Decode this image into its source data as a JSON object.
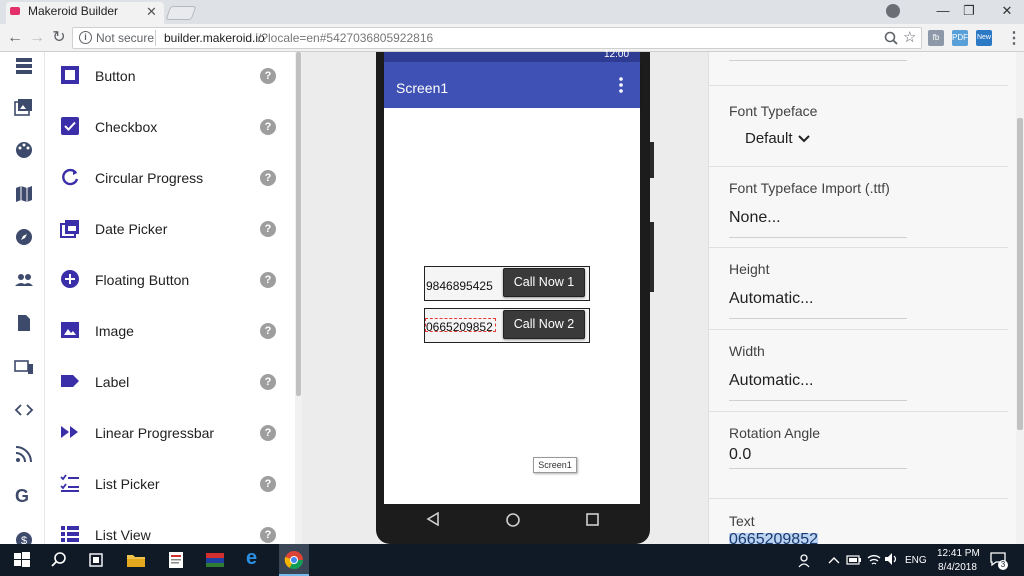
{
  "browser": {
    "tab_title": "Makeroid Builder",
    "tab_close": "✕",
    "window_controls": {
      "minimize": "—",
      "maximize": "❐",
      "close": "✕"
    },
    "security_label": "Not secure",
    "url_host": "builder.makeroid.io",
    "url_rest": "/?locale=en#5427036805922816",
    "extension_badge": "New"
  },
  "rail": {
    "icons": [
      "layers-icon",
      "image-gallery-icon",
      "palette-icon",
      "map-icon",
      "compass-icon",
      "people-icon",
      "document-icon",
      "devices-icon",
      "code-icon",
      "rss-icon",
      "google-icon",
      "dollar-icon"
    ]
  },
  "components": [
    {
      "label": "Button",
      "icon": "button-icon"
    },
    {
      "label": "Checkbox",
      "icon": "checkbox-icon"
    },
    {
      "label": "Circular Progress",
      "icon": "circular-progress-icon"
    },
    {
      "label": "Date Picker",
      "icon": "date-picker-icon"
    },
    {
      "label": "Floating Button",
      "icon": "floating-button-icon"
    },
    {
      "label": "Image",
      "icon": "image-icon"
    },
    {
      "label": "Label",
      "icon": "label-icon"
    },
    {
      "label": "Linear Progressbar",
      "icon": "linear-progressbar-icon"
    },
    {
      "label": "List Picker",
      "icon": "list-picker-icon"
    },
    {
      "label": "List View",
      "icon": "list-view-icon"
    }
  ],
  "help_glyph": "?",
  "phone": {
    "status_time": "12:00",
    "screen_title": "Screen1",
    "rows": [
      {
        "number": "9846895425",
        "button": "Call Now 1"
      },
      {
        "number": "0665209852",
        "button": "Call Now 2"
      }
    ],
    "screen_tag": "Screen1"
  },
  "properties": {
    "font_typeface": {
      "label": "Font Typeface",
      "value": "Default"
    },
    "font_typeface_import": {
      "label": "Font Typeface Import (.ttf)",
      "value": "None..."
    },
    "height": {
      "label": "Height",
      "value": "Automatic..."
    },
    "width": {
      "label": "Width",
      "value": "Automatic..."
    },
    "rotation_angle": {
      "label": "Rotation Angle",
      "value": "0.0"
    },
    "text": {
      "label": "Text",
      "value": "0665209852"
    }
  },
  "taskbar": {
    "language": "ENG",
    "time": "12:41 PM",
    "date": "8/4/2018",
    "notification_count": "3"
  },
  "colors": {
    "brand_indigo": "#3f51b5",
    "component_icon": "#3a2fa8",
    "selection_outline": "#e53935"
  }
}
